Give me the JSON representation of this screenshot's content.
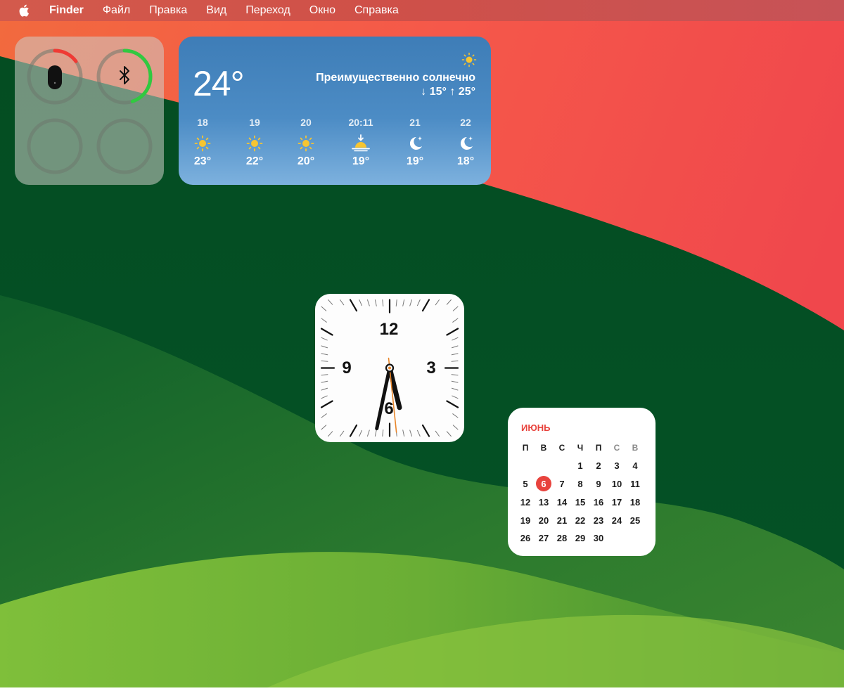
{
  "menubar": {
    "items": [
      "Finder",
      "Файл",
      "Правка",
      "Вид",
      "Переход",
      "Окно",
      "Справка"
    ],
    "apple_icon": "apple-logo-icon"
  },
  "batteries": {
    "devices": [
      {
        "icon": "mouse-icon",
        "level": 0.15,
        "color": "#f03a34"
      },
      {
        "icon": "bluetooth-icon",
        "level": 0.45,
        "color": "#31c940"
      },
      {
        "icon": "empty-slot",
        "level": 0
      },
      {
        "icon": "empty-slot",
        "level": 0
      }
    ]
  },
  "weather": {
    "current_temp": "24°",
    "condition": "Преимущественно солнечно",
    "range": "↓ 15° ↑ 25°",
    "top_icon": "sun-icon",
    "hourly": [
      {
        "time": "18",
        "icon": "sun",
        "temp": "23°"
      },
      {
        "time": "19",
        "icon": "sun",
        "temp": "22°"
      },
      {
        "time": "20",
        "icon": "sun",
        "temp": "20°"
      },
      {
        "time": "20:11",
        "icon": "sunset",
        "temp": "19°"
      },
      {
        "time": "21",
        "icon": "moon",
        "temp": "19°"
      },
      {
        "time": "22",
        "icon": "moon",
        "temp": "18°"
      }
    ]
  },
  "clock": {
    "numerals": [
      "12",
      "3",
      "6",
      "9"
    ],
    "hour": 5,
    "minute": 32,
    "second": 29,
    "accent": "#e8862a"
  },
  "calendar": {
    "month": "ИЮНЬ",
    "weekdays": [
      "П",
      "В",
      "С",
      "Ч",
      "П",
      "С",
      "В"
    ],
    "first_weekday_index": 3,
    "days_in_month": 30,
    "today": "6",
    "accent": "#e8433d"
  }
}
